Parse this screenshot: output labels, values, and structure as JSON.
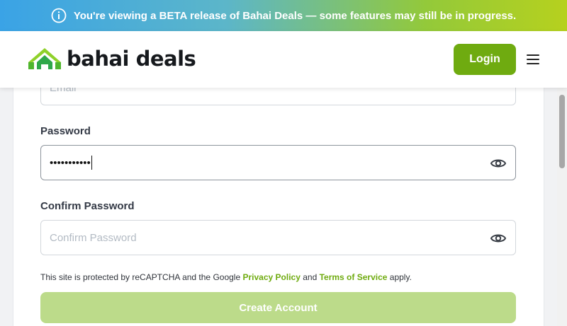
{
  "banner": {
    "message": "You're viewing a BETA release of Bahai Deals — some features may still be in progress.",
    "icon": "info-circle-icon"
  },
  "header": {
    "logo_text": "bahai deals",
    "login_label": "Login",
    "menu_icon": "hamburger-menu-icon"
  },
  "form": {
    "email": {
      "placeholder": "Email"
    },
    "password": {
      "label": "Password",
      "value_masked": "•••••••••••",
      "icon": "eye-icon"
    },
    "confirm_password": {
      "label": "Confirm Password",
      "placeholder": "Confirm Password",
      "icon": "eye-icon"
    },
    "recaptcha": {
      "prefix": "This site is protected by reCAPTCHA and the Google",
      "privacy_link": "Privacy Policy",
      "and": "and",
      "terms_link": "Terms of Service",
      "suffix": "apply."
    },
    "submit_label": "Create Account"
  },
  "colors": {
    "brand_green": "#6fab10",
    "disabled_green": "#bcdb8a",
    "banner_gradient_start": "#3aa3e6",
    "banner_gradient_end": "#b6d11e"
  }
}
